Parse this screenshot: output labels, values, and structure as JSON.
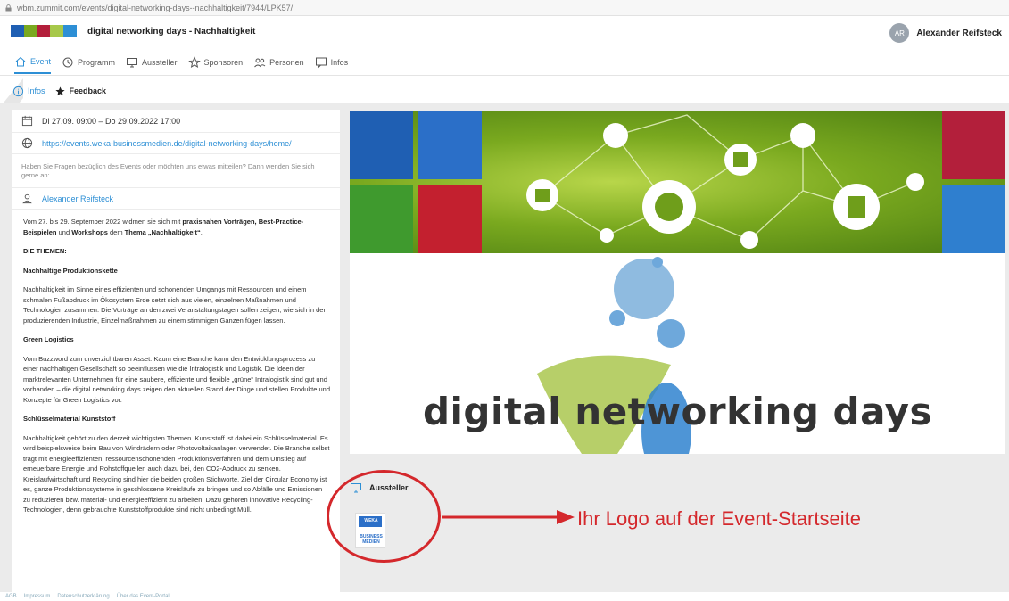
{
  "browser": {
    "url": "wbm.zummit.com/events/digital-networking-days--nachhaltigkeit/7944/LPK57/"
  },
  "header": {
    "title": "digital networking days - Nachhaltigkeit",
    "user_initials": "AR",
    "user_name": "Alexander Reifsteck"
  },
  "tabs": [
    "Event",
    "Programm",
    "Aussteller",
    "Sponsoren",
    "Personen",
    "Infos"
  ],
  "subtabs": [
    "Infos",
    "Feedback"
  ],
  "info": {
    "date": "Di 27.09. 09:00 – Do 29.09.2022 17:00",
    "link": "https://events.weka-businessmedien.de/digital-networking-days/home/",
    "hint": "Haben Sie Fragen bezüglich des Events oder möchten uns etwas mitteilen? Dann wenden Sie sich gerne an:",
    "contact": "Alexander Reifsteck"
  },
  "description": {
    "intro_1": "Vom 27. bis 29. September 2022 widmen sie sich mit ",
    "intro_b1": "praxisnahen Vorträgen, Best-Practice-Beispielen",
    "intro_2": " und ",
    "intro_b2": "Workshops",
    "intro_3": " dem ",
    "intro_b3": "Thema „Nachhaltigkeit“",
    "intro_4": ".",
    "themes_head": "DIE THEMEN:",
    "s1_head": "Nachhaltige Produktionskette",
    "s1_text": "Nachhaltigkeit im Sinne eines effizienten und schonenden Umgangs mit Ressourcen und einem schmalen Fußabdruck im Ökosystem Erde setzt sich aus vielen, einzelnen Maßnahmen und Technologien zusammen. Die Vorträge an den zwei Veranstaltungstagen sollen zeigen, wie sich in der produzierenden Industrie, Einzelmaßnahmen zu einem stimmigen Ganzen fügen lassen.",
    "s2_head": "Green Logistics",
    "s2_text": "Vom Buzzword zum unverzichtbaren Asset: Kaum eine Branche kann den Entwicklungsprozess zu einer nachhaltigen Gesellschaft so beeinflussen wie die Intralogistik und Logistik. Die Ideen der marktrelevanten Unternehmen für eine saubere, effiziente und flexible „grüne“ Intralogistik sind gut und vorhanden – die digital networking days zeigen den aktuellen Stand der Dinge und stellen Produkte und Konzepte für Green Logistics vor.",
    "s3_head": "Schlüsselmaterial Kunststoff",
    "s3_text": "Nachhaltigkeit gehört zu den derzeit wichtigsten Themen. Kunststoff ist dabei ein Schlüsselmaterial. Es wird beispielsweise beim Bau von Windrädern oder Photovoltaikanlagen verwendet. Die Branche selbst trägt mit energieeffizienten, ressourcenschonenden Produktionsverfahren und dem Umstieg auf erneuerbare Energie und Rohstoffquellen auch dazu bei, den CO2-Abdruck zu senken. Kreislaufwirtschaft und Recycling sind hier die beiden großen Stichworte. Ziel der Circular Economy ist es, ganze Produktionssysteme in geschlossene Kreisläufe zu bringen und so Abfälle und Emissionen zu reduzieren bzw. material- und energieeffizient zu arbeiten. Dazu gehören innovative Recycling-Technologien, denn gebrauchte Kunststoffprodukte sind nicht unbedingt Müll."
  },
  "banner": {
    "wordmark": "digital networking days"
  },
  "exhibitors": {
    "heading": "Aussteller",
    "logo_line1": "WEKA",
    "logo_line2": "BUSINESS",
    "logo_line3": "MEDIEN"
  },
  "annotation": {
    "text": "Ihr Logo auf der Event-Startseite",
    "color": "#d4282c"
  },
  "footer": [
    "AGB",
    "Impressum",
    "Datenschutzerklärung",
    "Über das Event-Portal"
  ],
  "colors": {
    "accent": "#2d8fd5",
    "callout_red": "#d4282c",
    "banner_green": "#7aa91f"
  }
}
